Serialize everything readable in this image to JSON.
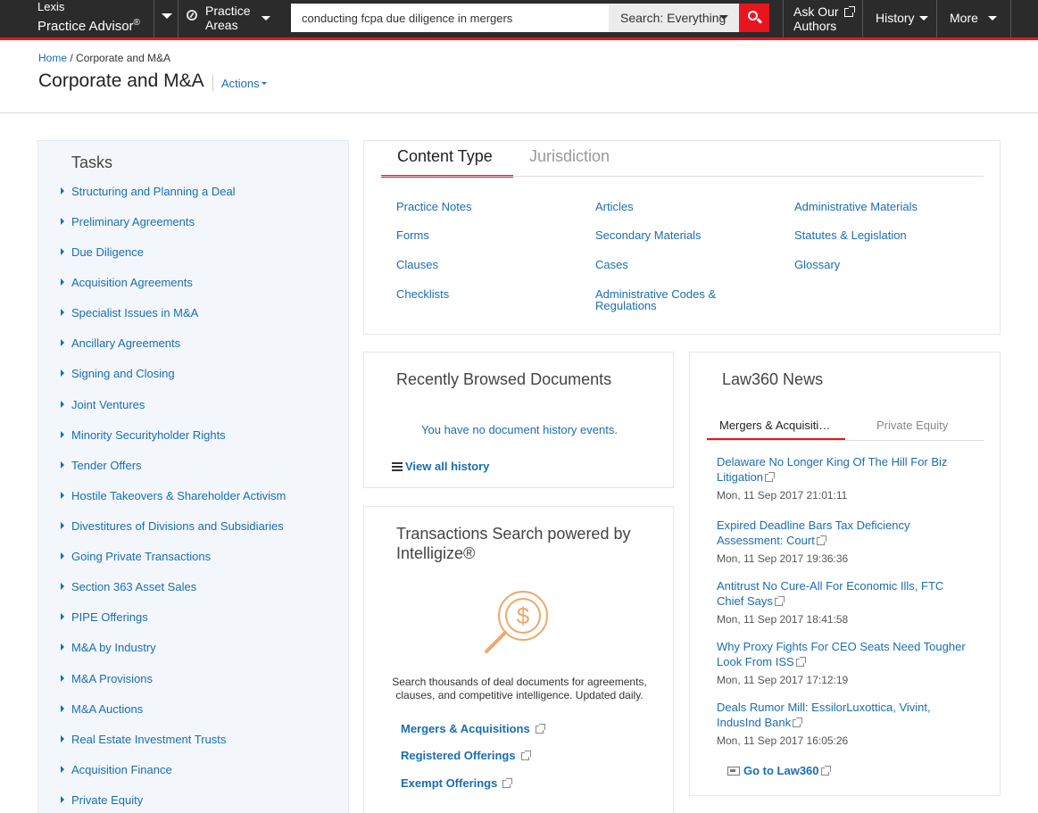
{
  "topbar": {
    "brand_line1": "Lexis",
    "brand_line2": "Practice Advisor",
    "brand_mark": "®",
    "practice_areas_line1": "Practice",
    "practice_areas_line2": "Areas",
    "search_value": "conducting fcpa due diligence in mergers",
    "search_scope": "Search: Everything",
    "ask_line1": "Ask Our",
    "ask_line2": "Authors",
    "history": "History",
    "more": "More",
    "accent_color": "#e8141e"
  },
  "breadcrumb": {
    "home": "Home",
    "separator": "/",
    "current": "Corporate and M&A"
  },
  "header": {
    "title": "Corporate and M&A",
    "actions": "Actions"
  },
  "tasks": {
    "title": "Tasks",
    "items": [
      "Structuring and Planning a Deal",
      "Preliminary Agreements",
      "Due Diligence",
      "Acquisition Agreements",
      "Specialist Issues in M&A",
      "Ancillary Agreements",
      "Signing and Closing",
      "Joint Ventures",
      "Minority Securityholder Rights",
      "Tender Offers",
      "Hostile Takeovers & Shareholder Activism",
      "Divestitures of Divisions and Subsidiaries",
      "Going Private Transactions",
      "Section 363 Asset Sales",
      "PIPE Offerings",
      "M&A by Industry",
      "M&A Provisions",
      "M&A Auctions",
      "Real Estate Investment Trusts",
      "Acquisition Finance",
      "Private Equity"
    ]
  },
  "content_type": {
    "tab_active": "Content Type",
    "tab_inactive": "Jurisdiction",
    "col1": [
      "Practice Notes",
      "Forms",
      "Clauses",
      "Checklists"
    ],
    "col2": [
      "Articles",
      "Secondary Materials",
      "Cases",
      "Administrative Codes &",
      "Regulations"
    ],
    "col3": [
      "Administrative Materials",
      "Statutes & Legislation",
      "Glossary"
    ]
  },
  "recent": {
    "title": "Recently Browsed Documents",
    "empty": "You have no document history events.",
    "view_all": "View all history"
  },
  "transactions": {
    "title_line1": "Transactions Search powered by",
    "title_line2": "Intelligize®",
    "desc_line1": "Search thousands of deal documents for agreements,",
    "desc_line2": "clauses, and competitive intelligence. Updated daily.",
    "links": [
      "Mergers & Acquisitions",
      "Registered Offerings",
      "Exempt Offerings"
    ],
    "icon": "dollar-magnifier-icon",
    "icon_color": "#f0a868"
  },
  "law360": {
    "title": "Law360 News",
    "tab_active": "Mergers & Acquisiti…",
    "tab_inactive": "Private Equity",
    "news": [
      {
        "line1": "Delaware No Longer King Of The Hill For Biz",
        "line2": "Litigation",
        "date": "Mon, 11 Sep 2017 21:01:11"
      },
      {
        "line1": "Expired Deadline Bars Tax Deficiency",
        "line2": "Assessment: Court",
        "date": "Mon, 11 Sep 2017 19:36:36"
      },
      {
        "line1": "Antitrust No Cure-All For Economic Ills, FTC",
        "line2": "Chief Says",
        "date": "Mon, 11 Sep 2017 18:41:58"
      },
      {
        "line1": "Why Proxy Fights For CEO Seats Need Tougher",
        "line2": "Look From ISS",
        "date": "Mon, 11 Sep 2017 17:12:19"
      },
      {
        "line1": "Deals Rumor Mill: EssilorLuxottica, Vivint,",
        "line2": "IndusInd Bank",
        "date": "Mon, 11 Sep 2017 16:05:26"
      }
    ],
    "goto": "Go to Law360"
  }
}
